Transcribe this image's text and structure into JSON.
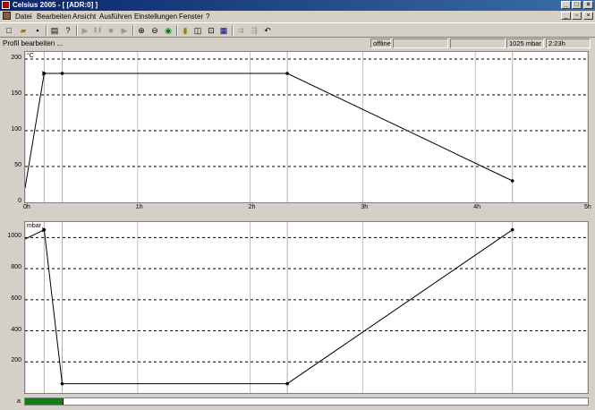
{
  "window": {
    "title": "Celsius 2005 - [ [ADR:0] ]",
    "minimize_glyph": "_",
    "maximize_glyph": "□",
    "close_glyph": "×",
    "mdi_minimize_glyph": "_",
    "mdi_restore_glyph": "▫",
    "mdi_close_glyph": "×"
  },
  "menu": [
    "Datei",
    "Bearbeiten",
    "Ansicht",
    "Ausführen",
    "Einstellungen",
    "Fenster",
    "?"
  ],
  "toolbar": {
    "new": "□",
    "open": "▰",
    "save": "▪",
    "print": "▤",
    "help": "?",
    "run": "▶",
    "pause": "❚❚",
    "stop": "■",
    "step": "▶",
    "zoom_in": "⊕",
    "zoom_out": "⊖",
    "zoom_fit": "◉",
    "view1": "▮",
    "view2": "◫",
    "view3": "⊡",
    "view4": "▦",
    "edit1": "⇉",
    "edit2": "⇶",
    "undo": "↶"
  },
  "status": {
    "message": "Profil bearbeiten ...",
    "connection": "offline",
    "pressure": "1025 mbar",
    "duration": "2:23h"
  },
  "progress": {
    "label": "a",
    "fraction": 0.068
  },
  "colors": {
    "active_title": "#0a246a",
    "progress": "#108010",
    "face": "#d4d0c8"
  },
  "chart_data": [
    {
      "type": "line",
      "unit": "°C",
      "x_unit": "h",
      "xlim": [
        0,
        5
      ],
      "ylim": [
        0,
        210
      ],
      "y_ticks": [
        "0",
        "50",
        "100",
        "150",
        "200"
      ],
      "x_ticks": [
        "0h",
        "1h",
        "2h",
        "3h",
        "4h",
        "5h"
      ],
      "points": [
        {
          "x": 0.0,
          "y": 20
        },
        {
          "x": 0.17,
          "y": 180
        },
        {
          "x": 0.33,
          "y": 180
        },
        {
          "x": 2.33,
          "y": 180
        },
        {
          "x": 4.33,
          "y": 30
        }
      ],
      "markers": [
        1,
        2,
        3,
        4
      ],
      "vlines": [
        0.17,
        0.33,
        2.33,
        4.33
      ]
    },
    {
      "type": "line",
      "unit": "mbar",
      "x_unit": "h",
      "xlim": [
        0,
        5
      ],
      "ylim": [
        0,
        1100
      ],
      "y_ticks": [
        "200",
        "400",
        "600",
        "800",
        "1000"
      ],
      "points": [
        {
          "x": 0.0,
          "y": 990
        },
        {
          "x": 0.17,
          "y": 1050
        },
        {
          "x": 0.33,
          "y": 60
        },
        {
          "x": 2.33,
          "y": 60
        },
        {
          "x": 4.33,
          "y": 1050
        }
      ],
      "markers": [
        1,
        2,
        3,
        4
      ],
      "vlines": [
        0.17,
        0.33,
        2.33,
        4.33
      ]
    }
  ]
}
